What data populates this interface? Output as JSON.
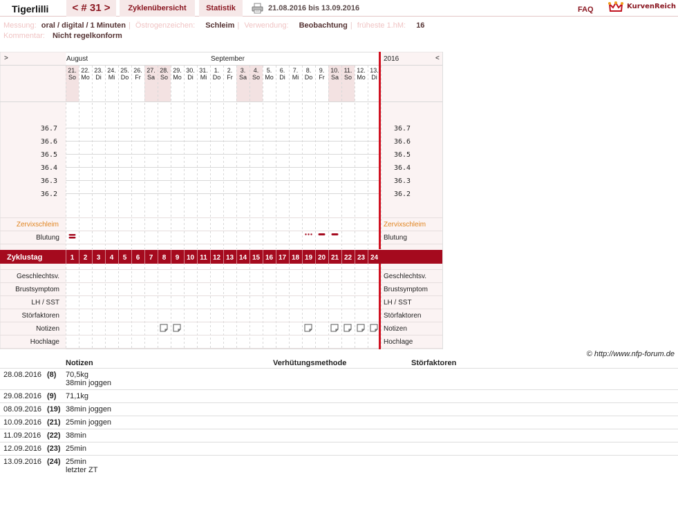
{
  "header": {
    "user": "Tigerlilli",
    "cycle_nav": "< # 31 >",
    "tab_overview": "Zyklenübersicht",
    "tab_stats": "Statistik",
    "date_range": "21.08.2016 bis 13.09.2016",
    "faq": "FAQ",
    "logo_text": "KurvenReich"
  },
  "info": {
    "messung_label": "Messung:",
    "messung_value": "oral / digital / 1 Minuten",
    "oestrogen_label": "Östrogenzeichen:",
    "oestrogen_value": "Schleim",
    "verwendung_label": "Verwendung:",
    "verwendung_value": "Beobachtung",
    "fruehe_label": "früheste 1.hM:",
    "fruehe_value": "16",
    "kommentar_label": "Kommentar:",
    "kommentar_value": "Nicht regelkonform"
  },
  "chart": {
    "nav_prev": ">",
    "nav_next": "<",
    "months": [
      {
        "label": "August",
        "col": 0
      },
      {
        "label": "September",
        "col": 11
      }
    ],
    "year": "2016",
    "days": [
      {
        "d": "21.",
        "w": "So",
        "we": true
      },
      {
        "d": "22.",
        "w": "Mo",
        "we": false
      },
      {
        "d": "23.",
        "w": "Di",
        "we": false
      },
      {
        "d": "24.",
        "w": "Mi",
        "we": false
      },
      {
        "d": "25.",
        "w": "Do",
        "we": false
      },
      {
        "d": "26.",
        "w": "Fr",
        "we": false
      },
      {
        "d": "27.",
        "w": "Sa",
        "we": true
      },
      {
        "d": "28.",
        "w": "So",
        "we": true
      },
      {
        "d": "29.",
        "w": "Mo",
        "we": false
      },
      {
        "d": "30.",
        "w": "Di",
        "we": false
      },
      {
        "d": "31.",
        "w": "Mi",
        "we": false
      },
      {
        "d": "1.",
        "w": "Do",
        "we": false
      },
      {
        "d": "2.",
        "w": "Fr",
        "we": false
      },
      {
        "d": "3.",
        "w": "Sa",
        "we": true
      },
      {
        "d": "4.",
        "w": "So",
        "we": true
      },
      {
        "d": "5.",
        "w": "Mo",
        "we": false
      },
      {
        "d": "6.",
        "w": "Di",
        "we": false
      },
      {
        "d": "7.",
        "w": "Mi",
        "we": false
      },
      {
        "d": "8.",
        "w": "Do",
        "we": false
      },
      {
        "d": "9.",
        "w": "Fr",
        "we": false
      },
      {
        "d": "10.",
        "w": "Sa",
        "we": true
      },
      {
        "d": "11.",
        "w": "So",
        "we": true
      },
      {
        "d": "12.",
        "w": "Mo",
        "we": false
      },
      {
        "d": "13.",
        "w": "Di",
        "we": false
      }
    ],
    "temp_labels": [
      "36.7",
      "36.6",
      "36.5",
      "36.4",
      "36.3",
      "36.2"
    ],
    "zervix_label": "Zervixschleim",
    "blutung_label": "Blutung",
    "blutung_marks": [
      {
        "day": 1,
        "type": "strong"
      },
      {
        "day": 19,
        "type": "spotting"
      },
      {
        "day": 20,
        "type": "light"
      },
      {
        "day": 21,
        "type": "light"
      }
    ],
    "zyklustag_label": "Zyklustag",
    "zyklustage": [
      "1",
      "2",
      "3",
      "4",
      "5",
      "6",
      "7",
      "8",
      "9",
      "10",
      "11",
      "12",
      "13",
      "14",
      "15",
      "16",
      "17",
      "18",
      "19",
      "20",
      "21",
      "22",
      "23",
      "24"
    ],
    "rows": [
      "Geschlechtsv.",
      "Brustsymptom",
      "LH / SST",
      "Störfaktoren",
      "Notizen",
      "Hochlage"
    ],
    "notiz_days": [
      8,
      9,
      19,
      21,
      22,
      23,
      24
    ],
    "colors": {
      "accent": "#a50a1e",
      "weekend": "#f3e2e2",
      "grid": "#d8d8d8",
      "zervix": "#e0841f",
      "panel": "#fbf3f3"
    }
  },
  "copyright": "© http://www.nfp-forum.de",
  "notes": {
    "headers": {
      "notizen": "Notizen",
      "verhuetung": "Verhütungsmethode",
      "stoer": "Störfaktoren"
    },
    "rows": [
      {
        "date": "28.08.2016",
        "cd": "(8)",
        "lines": [
          "70,5kg",
          "38min joggen"
        ]
      },
      {
        "date": "29.08.2016",
        "cd": "(9)",
        "lines": [
          "71,1kg"
        ]
      },
      {
        "date": "08.09.2016",
        "cd": "(19)",
        "lines": [
          "38min joggen"
        ]
      },
      {
        "date": "10.09.2016",
        "cd": "(21)",
        "lines": [
          "25min joggen"
        ]
      },
      {
        "date": "11.09.2016",
        "cd": "(22)",
        "lines": [
          "38min"
        ]
      },
      {
        "date": "12.09.2016",
        "cd": "(23)",
        "lines": [
          "25min"
        ]
      },
      {
        "date": "13.09.2016",
        "cd": "(24)",
        "lines": [
          "25min",
          "letzter ZT"
        ]
      }
    ]
  }
}
